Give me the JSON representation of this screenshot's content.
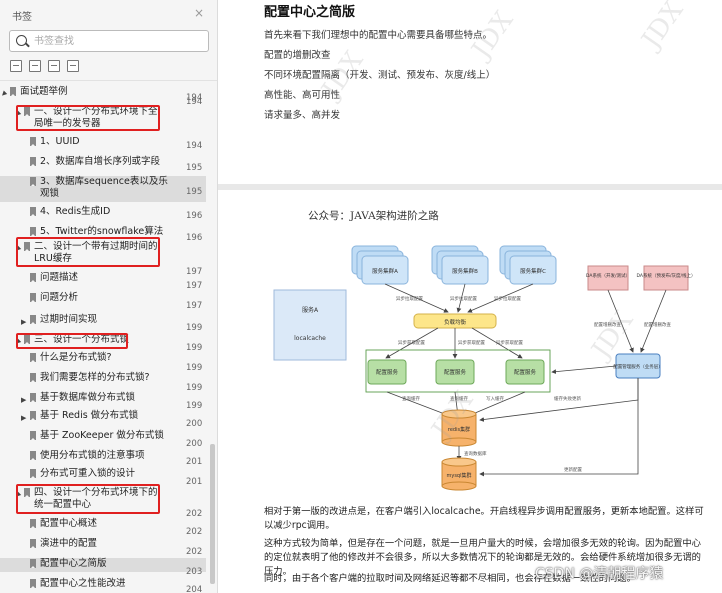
{
  "sidebar": {
    "title": "书签",
    "close_glyph": "×",
    "search_placeholder": "书签查找",
    "tool_icons": [
      "expand-all-icon",
      "collapse-all-icon",
      "add-bookmark-icon",
      "bookmark-icon"
    ],
    "items": [
      {
        "label": "面试题举例",
        "page": "194",
        "level": 0,
        "expanded": true
      },
      {
        "label": "一、设计一个分布式环境下全局唯一的发号器",
        "page": "194",
        "level": 1,
        "expanded": true,
        "highlight": true
      },
      {
        "label": "1、UUID",
        "page": "194",
        "level": 2
      },
      {
        "label": "2、数据库自增长序列或字段",
        "page": "195",
        "level": 2
      },
      {
        "label": "3、数据库sequence表以及乐观锁",
        "page": "195",
        "level": 2,
        "selected": true
      },
      {
        "label": "4、Redis生成ID",
        "page": "196",
        "level": 2
      },
      {
        "label": "5、Twitter的snowflake算法",
        "page": "196",
        "level": 2
      },
      {
        "label": "二、设计一个带有过期时间的LRU缓存",
        "page": "197",
        "level": 1,
        "expanded": true,
        "highlight": true
      },
      {
        "label": "问题描述",
        "page": "197",
        "level": 2
      },
      {
        "label": "问题分析",
        "page": "197",
        "level": 2
      },
      {
        "label": "过期时间实现",
        "page": "199",
        "level": 2,
        "expanded": false
      },
      {
        "label": "三、设计一个分布式锁",
        "page": "199",
        "level": 1,
        "expanded": true,
        "highlight": true
      },
      {
        "label": "什么是分布式锁?",
        "page": "199",
        "level": 2
      },
      {
        "label": "我们需要怎样的分布式锁?",
        "page": "199",
        "level": 2
      },
      {
        "label": "基于数据库做分布式锁",
        "page": "199",
        "level": 2,
        "expanded": false
      },
      {
        "label": "基于 Redis 做分布式锁",
        "page": "200",
        "level": 2,
        "expanded": false
      },
      {
        "label": "基于 ZooKeeper 做分布式锁",
        "page": "200",
        "level": 2
      },
      {
        "label": "使用分布式锁的注意事项",
        "page": "201",
        "level": 2
      },
      {
        "label": "分布式可重入锁的设计",
        "page": "201",
        "level": 2
      },
      {
        "label": "四、设计一个分布式环境下的统一配置中心",
        "page": "202",
        "level": 1,
        "expanded": true,
        "highlight": true
      },
      {
        "label": "配置中心概述",
        "page": "202",
        "level": 2
      },
      {
        "label": "演进中的配置",
        "page": "202",
        "level": 2
      },
      {
        "label": "配置中心之简版",
        "page": "203",
        "level": 2,
        "selected": true
      },
      {
        "label": "配置中心之性能改进",
        "page": "204",
        "level": 2
      }
    ]
  },
  "document": {
    "section_title": "配置中心之简版",
    "intro_lines": [
      "首先来看下我们理想中的配置中心需要具备哪些特点。",
      "配置的增删改查",
      "不同环境配置隔离（开发、测试、预发布、灰度/线上）",
      "高性能、高可用性",
      "请求量多、高并发"
    ],
    "figure_caption": "公众号：JAVA架构进阶之路",
    "diagram": {
      "services": [
        "服务集群A",
        "服务集群B",
        "服务集群C"
      ],
      "left_group": [
        "服务A",
        "localcache"
      ],
      "lb": "负载均衡",
      "config_nodes": [
        "配置服务",
        "配置服务",
        "配置服务"
      ],
      "cache": "redis集群",
      "db": "mysql集群",
      "right_systems": [
        "DA系统（开发/测试）",
        "DA系统（预发布/灰度/线上）"
      ],
      "manager": "配置管理服务（业务层）",
      "edge_labels": {
        "pull": "异步拉取配置",
        "req": "异步获取配置",
        "cache_read": "查询缓存",
        "cache_write": "写入缓存",
        "cache_update": "缓存失败更新",
        "db_read": "查询数据库",
        "notify_sub": "更新&通知配置",
        "admin1": "配置增删改查",
        "admin2": "配置增删改查",
        "db_write": "更新配置"
      }
    },
    "paragraphs": [
      "相对于第一版的改进点是，在客户端引入localcache。开启线程异步调用配置服务，更新本地配置。这样可以减少rpc调用。",
      "这种方式较为简单，但是存在一个问题，就是一旦用户量大的时候，会增加很多无效的轮询。因为配置中心的定位就表明了他的修改并不会很多，所以大多数情况下的轮询都是无效的。会给硬件系统增加很多无谓的压力。",
      "同时，由于各个客户端的拉取时间及网络延迟等都不尽相同，也会存在数据一致性的问题。"
    ],
    "watermark_text": "JDX",
    "csdn_watermark": "CSDN @清朝程序猿"
  },
  "colors": {
    "highlight_red": "#e02020",
    "service_blue": "#bfdcf5",
    "lb_yellow": "#fde68a",
    "config_green": "#b7dfa5",
    "cache_orange": "#f6b26b",
    "system_pink": "#f4c2c2"
  }
}
